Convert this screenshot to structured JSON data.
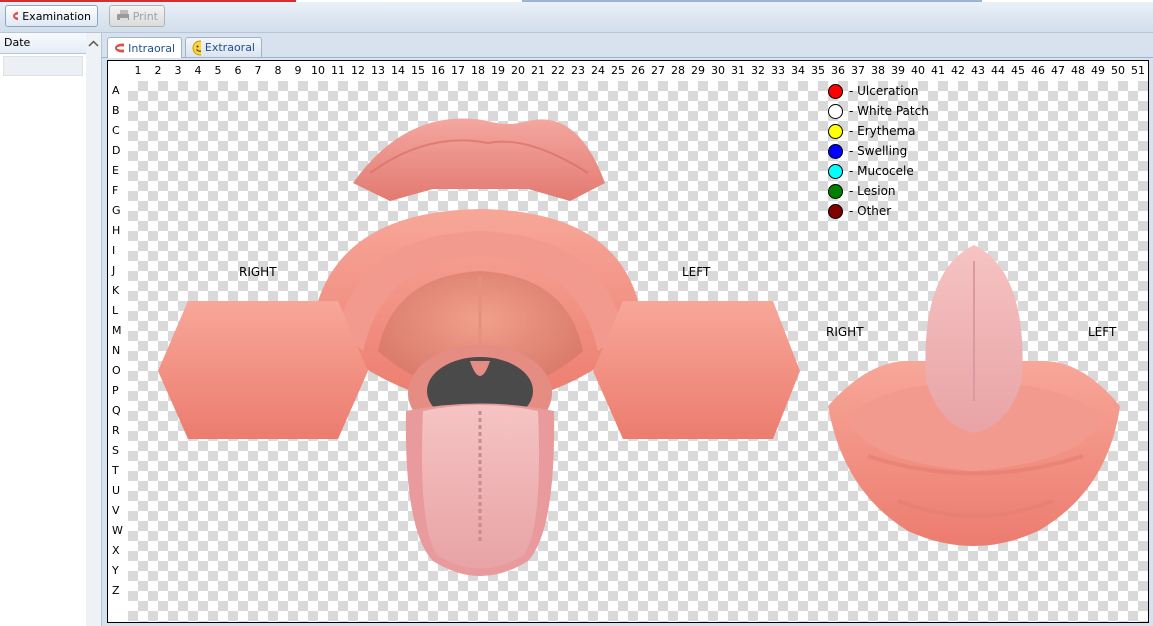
{
  "toolbar": {
    "examination_label": "Examination",
    "print_label": "Print"
  },
  "left_panel": {
    "date_header": "Date"
  },
  "tabs": [
    {
      "label": "Intraoral",
      "active": true
    },
    {
      "label": "Extraoral",
      "active": false
    }
  ],
  "grid": {
    "columns": [
      "1",
      "2",
      "3",
      "4",
      "5",
      "6",
      "7",
      "8",
      "9",
      "10",
      "11",
      "12",
      "13",
      "14",
      "15",
      "16",
      "17",
      "18",
      "19",
      "20",
      "21",
      "22",
      "23",
      "24",
      "25",
      "26",
      "27",
      "28",
      "29",
      "30",
      "31",
      "32",
      "33",
      "34",
      "35",
      "36",
      "37",
      "38",
      "39",
      "40",
      "41",
      "42",
      "43",
      "44",
      "45",
      "46",
      "47",
      "48",
      "49",
      "50",
      "51"
    ],
    "rows": [
      "A",
      "B",
      "C",
      "D",
      "E",
      "F",
      "G",
      "H",
      "I",
      "J",
      "K",
      "L",
      "M",
      "N",
      "O",
      "P",
      "Q",
      "R",
      "S",
      "T",
      "U",
      "V",
      "W",
      "X",
      "Y",
      "Z"
    ]
  },
  "legend": [
    {
      "label": "- Ulceration",
      "color": "#ff0000"
    },
    {
      "label": "- White Patch",
      "color": "#ffffff"
    },
    {
      "label": "- Erythema",
      "color": "#ffff00"
    },
    {
      "label": "- Swelling",
      "color": "#0000ff"
    },
    {
      "label": "- Mucocele",
      "color": "#00ffff"
    },
    {
      "label": "- Lesion",
      "color": "#008000"
    },
    {
      "label": "- Other",
      "color": "#800000"
    }
  ],
  "diagram_labels": {
    "main_right": "RIGHT",
    "main_left": "LEFT",
    "tongue_right": "RIGHT",
    "tongue_left": "LEFT"
  }
}
